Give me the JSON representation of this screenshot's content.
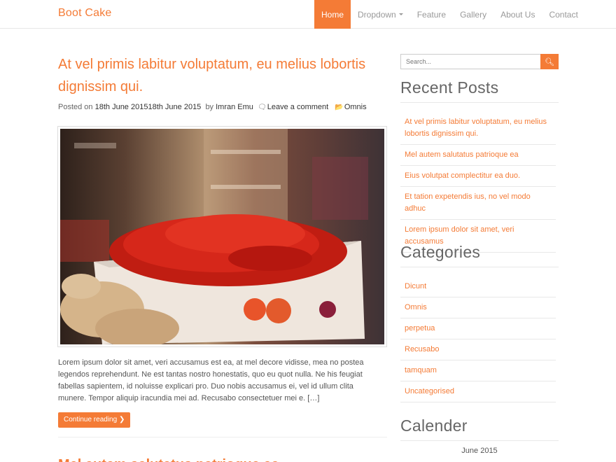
{
  "brand": "Boot Cake",
  "nav": {
    "items": [
      {
        "label": "Home",
        "active": true
      },
      {
        "label": "Dropdown",
        "has_caret": true
      },
      {
        "label": "Feature"
      },
      {
        "label": "Gallery"
      },
      {
        "label": "About Us"
      },
      {
        "label": "Contact"
      }
    ]
  },
  "post": {
    "title": "At vel primis labitur voluptatum, eu melius lobortis dignissim qui.",
    "meta": {
      "posted_on_label": "Posted on",
      "date": "18th June 201518th June 2015",
      "by_label": "by",
      "author": "Imran Emu",
      "comment": "Leave a comment",
      "category": "Omnis"
    },
    "excerpt": "Lorem ipsum dolor sit amet, veri accusamus est ea, at mel decore vidisse, mea no postea legendos reprehendunt. Ne est tantas nostro honestatis, quo eu quot nulla. Ne his feugiat fabellas sapientem, id noluisse explicari pro. Duo nobis accusamus ei, vel id ullum clita munere. Tempor aliquip iracundia mei ad.   Recusabo consectetuer mei e. […]",
    "continue_label": "Continue reading"
  },
  "next_post_title": "Mel autem salutatus patrioque ea",
  "sidebar": {
    "search_placeholder": "Search...",
    "recent_title": "Recent Posts",
    "recent_posts": [
      "At vel primis labitur voluptatum, eu melius lobortis dignissim qui.",
      "Mel autem salutatus patrioque ea",
      "Eius volutpat complectitur ea duo.",
      "Et tation expetendis ius, no vel modo adhuc",
      "Lorem ipsum dolor sit amet, veri accusamus"
    ],
    "categories_title": "Categories",
    "categories": [
      "Dicunt",
      "Omnis",
      "perpetua",
      "Recusabo",
      "tamquam",
      "Uncategorised"
    ],
    "calendar_title": "Calender",
    "calendar_month": "June 2015"
  },
  "colors": {
    "accent": "#f47b36",
    "text": "#555555",
    "border": "#e8e8e8"
  }
}
